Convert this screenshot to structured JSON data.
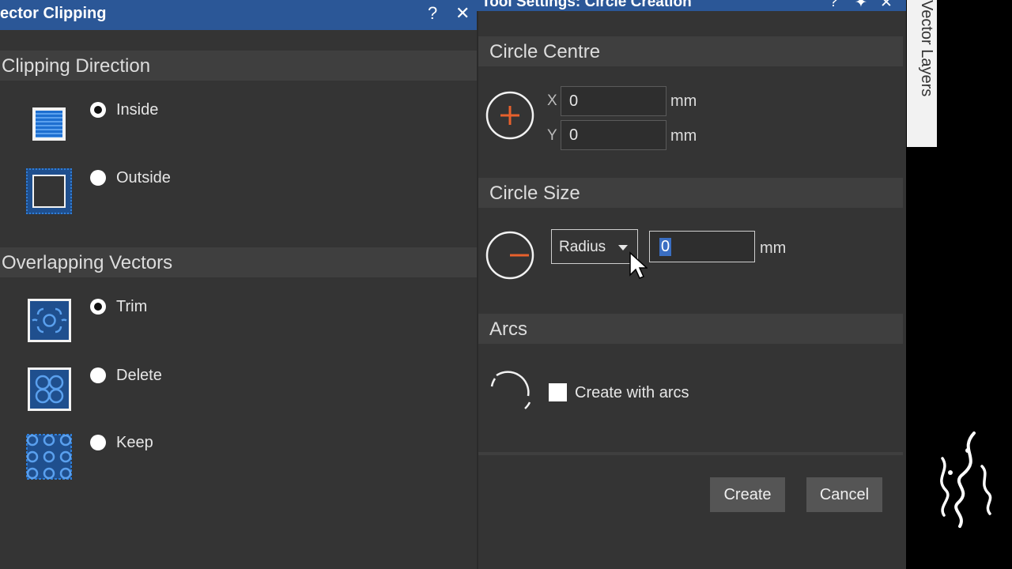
{
  "left_panel": {
    "title": "ector Clipping",
    "help_label": "?",
    "close_label": "✕",
    "clipping_direction": {
      "header": "Clipping Direction",
      "options": [
        {
          "label": "Inside",
          "checked": true
        },
        {
          "label": "Outside",
          "checked": false
        }
      ]
    },
    "overlapping_vectors": {
      "header": "Overlapping Vectors",
      "options": [
        {
          "label": "Trim",
          "checked": true
        },
        {
          "label": "Delete",
          "checked": false
        },
        {
          "label": "Keep",
          "checked": false
        }
      ]
    }
  },
  "right_panel": {
    "title": "Tool Settings: Circle Creation",
    "help_label": "?",
    "pin_label": "✦",
    "close_label": "✕",
    "circle_centre": {
      "header": "Circle Centre",
      "x_label": "X",
      "x_value": "0",
      "y_label": "Y",
      "y_value": "0",
      "unit": "mm"
    },
    "circle_size": {
      "header": "Circle Size",
      "mode": "Radius",
      "value": "0",
      "unit": "mm"
    },
    "arcs": {
      "header": "Arcs",
      "checkbox_label": "Create with arcs",
      "checked": false
    },
    "create_label": "Create",
    "cancel_label": "Cancel"
  },
  "side_tab": {
    "label": "Vector Layers"
  },
  "colors": {
    "titlebar": "#2b5797",
    "panel": "#343434",
    "accent_icon": "#2f7ed8",
    "orange": "#e8612c"
  }
}
